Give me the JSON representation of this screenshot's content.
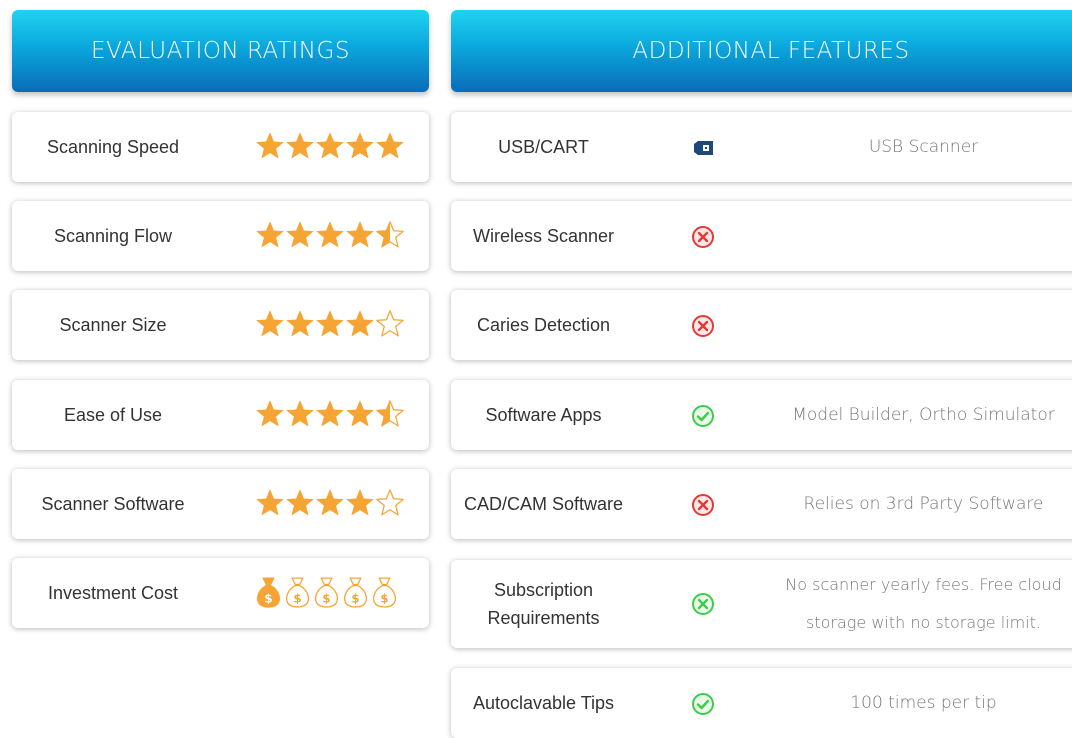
{
  "colors": {
    "star": "#f6a534",
    "cross": "#e53935",
    "check": "#3fcb4a",
    "header_top": "#20d3f1",
    "header_bottom": "#0a6bb8"
  },
  "headers": {
    "ratings": "EVALUATION RATINGS",
    "features": "ADDITIONAL FEATURES"
  },
  "ratings": [
    {
      "label": "Scanning Speed",
      "icon": "star-icon",
      "score": 5,
      "max": 5
    },
    {
      "label": "Scanning Flow",
      "icon": "star-icon",
      "score": 4.5,
      "max": 5
    },
    {
      "label": "Scanner Size",
      "icon": "star-icon",
      "score": 4,
      "max": 5
    },
    {
      "label": "Ease of Use",
      "icon": "star-icon",
      "score": 4.5,
      "max": 5
    },
    {
      "label": "Scanner Software",
      "icon": "star-icon",
      "score": 4,
      "max": 5
    },
    {
      "label": "Investment Cost",
      "icon": "money-bag-icon",
      "score": 1,
      "max": 5
    }
  ],
  "features": [
    {
      "label": "USB/CART",
      "icon": "usb-icon",
      "value": "USB Scanner"
    },
    {
      "label": "Wireless Scanner",
      "icon": "cross-circle-icon",
      "value": ""
    },
    {
      "label": "Caries Detection",
      "icon": "cross-circle-icon",
      "value": ""
    },
    {
      "label": "Software Apps",
      "icon": "check-circle-icon",
      "value": "Model Builder, Ortho Simulator"
    },
    {
      "label": "CAD/CAM Software",
      "icon": "cross-circle-icon",
      "value": "Relies on 3rd Party Software"
    },
    {
      "label": "Subscription Requirements",
      "icon": "cross-circle-green-icon",
      "value": "No scanner yearly fees. Free cloud storage with no storage limit."
    },
    {
      "label": "Autoclavable Tips",
      "icon": "check-circle-icon",
      "value": "100 times per tip"
    }
  ]
}
